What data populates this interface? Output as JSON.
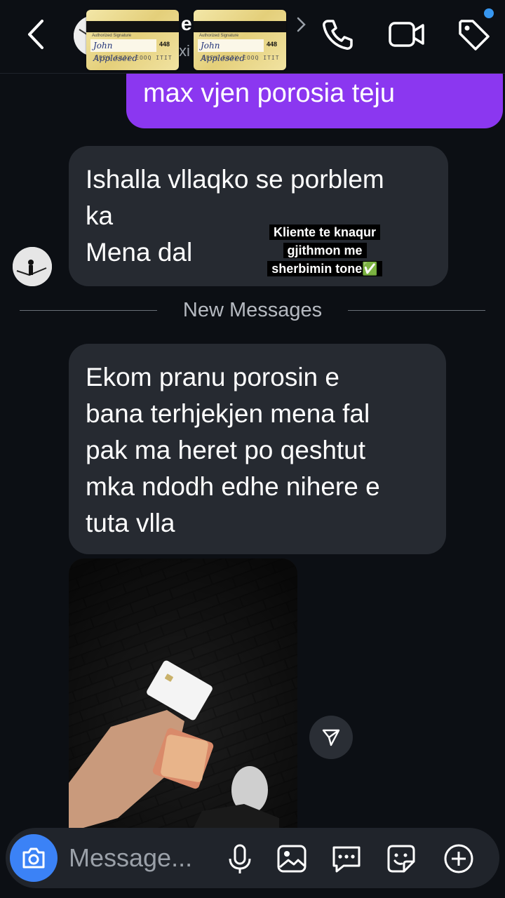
{
  "header": {
    "name_fragment": "e",
    "subtitle_fragment": "xi",
    "cards": [
      {
        "auth_label": "Authorized Signature",
        "signature": "John Appleseed",
        "cvv": "448",
        "numbers": "EEEY EXIY EOOQ ITIT"
      },
      {
        "auth_label": "Authorized Signature",
        "signature": "John Appleseed",
        "cvv": "448",
        "numbers": "EEEY EXIY EOOQ ITIT"
      }
    ],
    "icons": [
      "back-icon",
      "phone-icon",
      "video-icon",
      "tag-icon"
    ],
    "notification_dot_color": "#3797f0"
  },
  "messages": {
    "outgoing": [
      {
        "text": "max vjen porosia teju"
      }
    ],
    "incoming_1": {
      "lines": [
        "Ishalla vllaqko se porblem",
        "ka",
        "Mena dal"
      ]
    },
    "overlay_lines": [
      "Kliente te knaqur",
      "gjithmon me",
      "sherbimin tone✅"
    ],
    "divider_label": "New Messages",
    "incoming_2": {
      "lines": [
        "Ekom pranu porosin e",
        "bana terhjekjen mena fal",
        "pak ma heret po qeshtut",
        "mka ndodh edhe nihere e",
        "tuta vlla"
      ]
    }
  },
  "composer": {
    "placeholder": "Message...",
    "icons": [
      "camera-icon",
      "microphone-icon",
      "gallery-icon",
      "chat-bubble-icon",
      "sticker-icon",
      "plus-icon"
    ]
  },
  "colors": {
    "outgoing_bubble": "#8b37f0",
    "incoming_bubble": "#262a31",
    "camera_button": "#3b82f6",
    "background": "#0c0f14"
  }
}
